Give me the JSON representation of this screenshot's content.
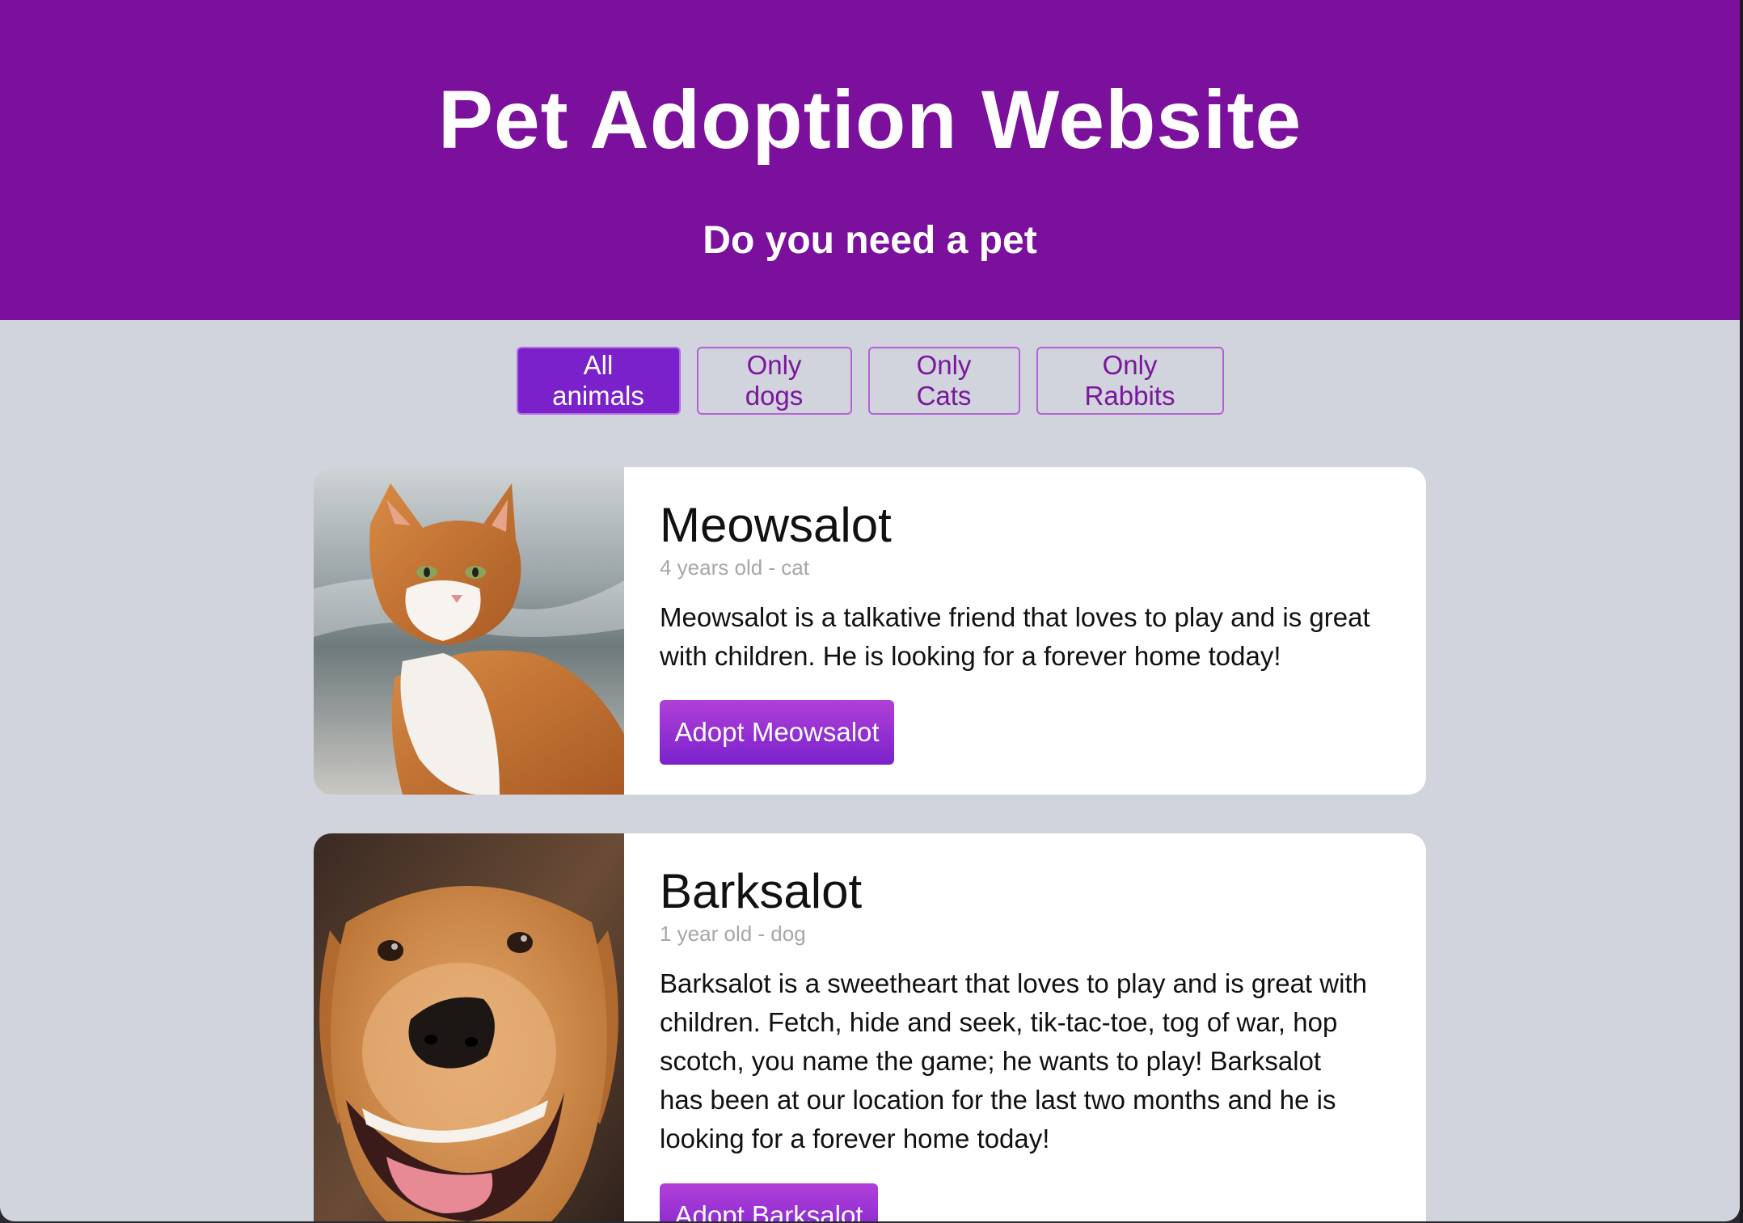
{
  "header": {
    "title": "Pet Adoption Website",
    "subtitle": "Do you need a pet"
  },
  "filters": [
    {
      "label": "All animals",
      "active": true
    },
    {
      "label": "Only dogs",
      "active": false
    },
    {
      "label": "Only Cats",
      "active": false
    },
    {
      "label": "Only Rabbits",
      "active": false
    }
  ],
  "pets": [
    {
      "name": "Meowsalot",
      "meta": "4 years old - cat",
      "description": "Meowsalot is a talkative friend that loves to play and is great with children. He is looking for a forever home today!",
      "button_label": "Adopt Meowsalot",
      "image": "orange-and-white-cat-photo"
    },
    {
      "name": "Barksalot",
      "meta": "1 year old - dog",
      "description": "Barksalot is a sweetheart that loves to play and is great with children. Fetch, hide and seek, tik-tac-toe, tog of war, hop scotch, you name the game; he wants to play! Barksalot has been at our location for the last two months and he is looking for a forever home today!",
      "button_label": "Adopt Barksalot",
      "image": "golden-retriever-photo"
    }
  ],
  "colors": {
    "header_bg": "#7b109c",
    "page_bg": "#d1d3dd",
    "accent": "#7a21cc",
    "card_bg": "#ffffff"
  }
}
